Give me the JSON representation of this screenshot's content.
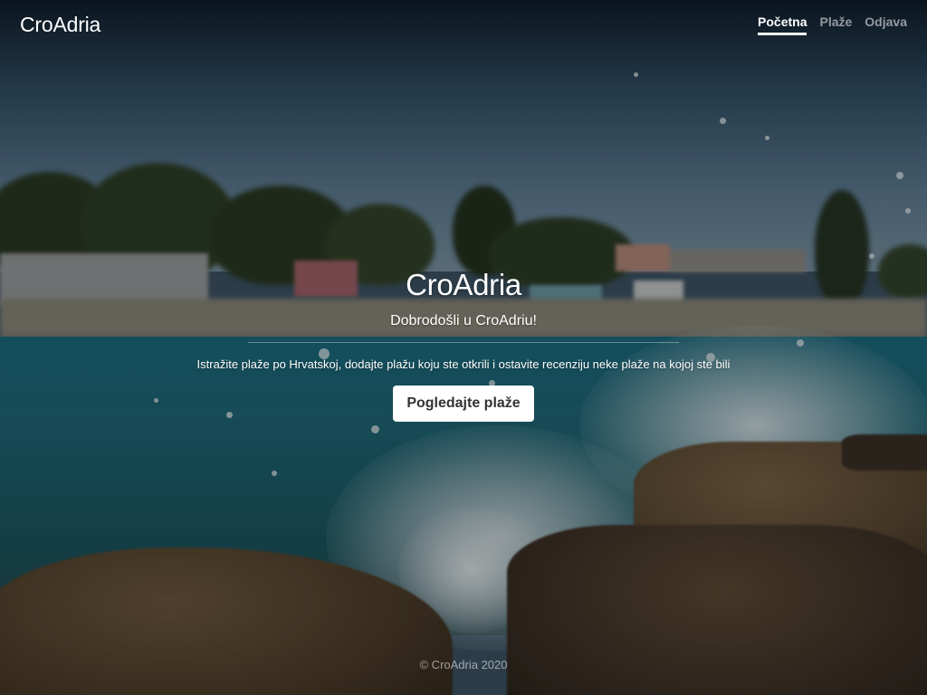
{
  "navbar": {
    "brand": "CroAdria",
    "links": [
      {
        "label": "Početna",
        "active": true
      },
      {
        "label": "Plaže",
        "active": false
      },
      {
        "label": "Odjava",
        "active": false
      }
    ]
  },
  "hero": {
    "title": "CroAdria",
    "subtitle": "Dobrodošli u CroAdriu!",
    "text": "Istražite plaže po Hrvatskoj, dodajte plažu koju ste otkrili i ostavite recenziju neke plaže na kojoj ste bili",
    "button_label": "Pogledajte plaže"
  },
  "footer": {
    "text": "© CroAdria 2020"
  },
  "colors": {
    "button_background": "#ffffff",
    "button_text": "#333333",
    "nav_active": "#ffffff",
    "nav_inactive": "rgba(255,255,255,0.55)"
  }
}
